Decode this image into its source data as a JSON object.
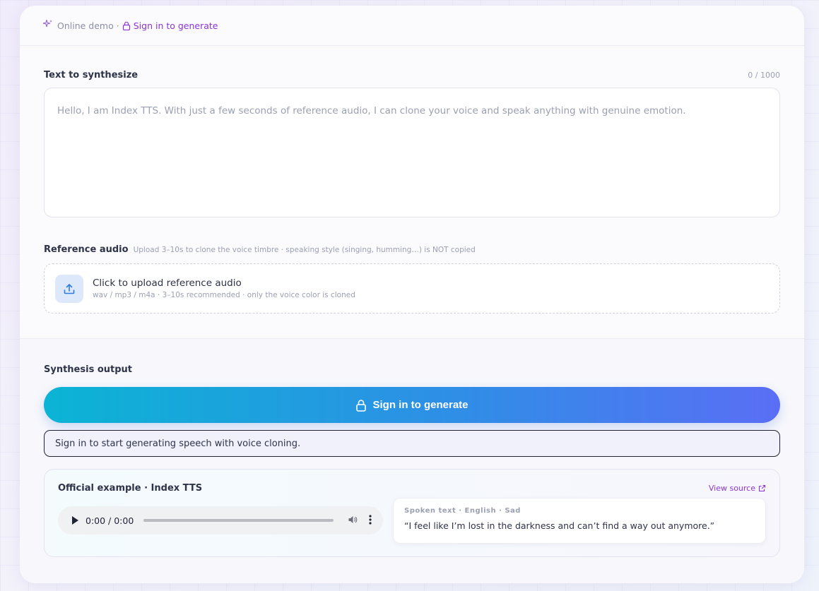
{
  "header": {
    "demo_label": "Online demo",
    "separator": "·",
    "signin_link": "Sign in to generate"
  },
  "text_section": {
    "label": "Text to synthesize",
    "char_count": "0 / 1000",
    "placeholder": "Hello, I am Index TTS. With just a few seconds of reference audio, I can clone your voice and speak anything with genuine emotion."
  },
  "reference": {
    "label": "Reference audio",
    "hint": "Upload 3–10s to clone the voice timbre · speaking style (singing, humming…) is NOT copied",
    "upload_title": "Click to upload reference audio",
    "upload_sub": "wav / mp3 / m4a · 3–10s recommended · only the voice color is cloned"
  },
  "output": {
    "label": "Synthesis output",
    "button_label": "Sign in to generate",
    "status_text": "Sign in to start generating speech with voice cloning."
  },
  "example": {
    "title": "Official example · Index TTS",
    "view_source": "View source",
    "audio_time": "0:00 / 0:00",
    "spoken_meta": "Spoken text · English · Sad",
    "spoken_text": "“I feel like I’m lost in the darkness and can’t find a way out anymore.”"
  },
  "colors": {
    "accent_purple": "#8b34d6",
    "gradient_start": "#0bb4d4",
    "gradient_end": "#5a6ef5"
  }
}
